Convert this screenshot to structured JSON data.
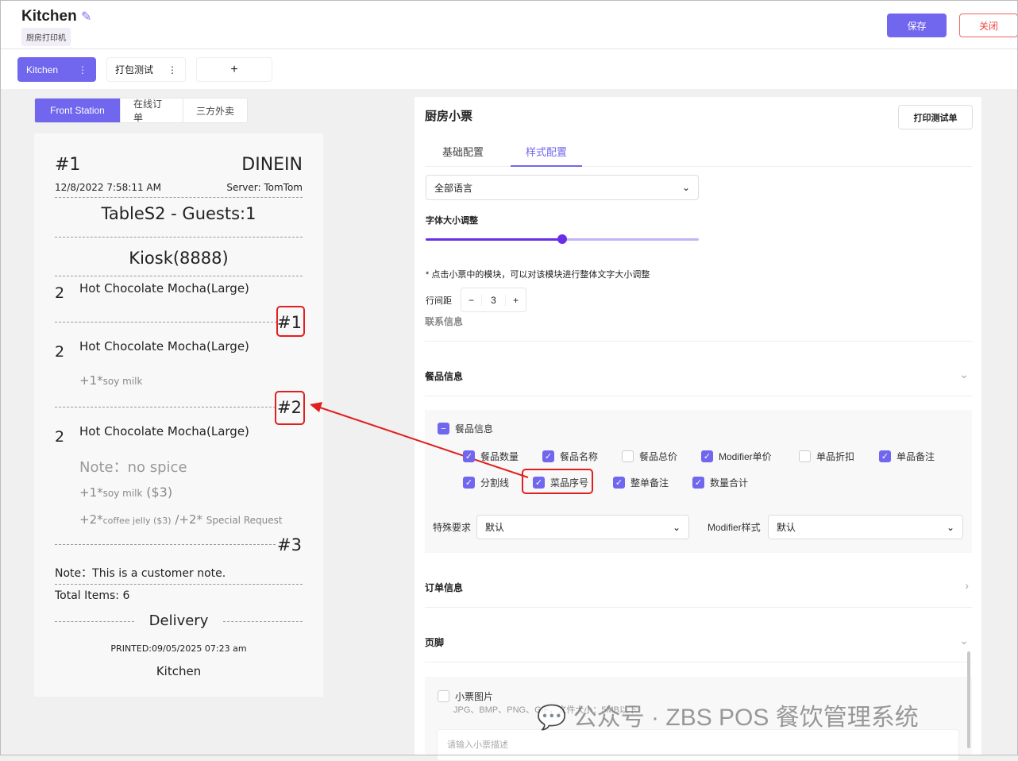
{
  "header": {
    "title": "Kitchen",
    "tag": "厨房打印机",
    "save": "保存",
    "close": "关闭"
  },
  "printer_tabs": [
    {
      "label": "Kitchen"
    },
    {
      "label": "打包测试"
    },
    {
      "label": "+"
    }
  ],
  "station_tabs": [
    "Front Station",
    "在线订单",
    "三方外卖"
  ],
  "receipt": {
    "order_no": "#1",
    "order_type": "DINEIN",
    "datetime": "12/8/2022 7:58:11 AM",
    "server": "Server: TomTom",
    "table": "TableS2 - Guests:1",
    "kiosk": "Kiosk(8888)",
    "items": [
      {
        "qty": "2",
        "name": "Hot Chocolate Mocha(Large)",
        "seq": "#1"
      },
      {
        "qty": "2",
        "name": "Hot Chocolate Mocha(Large)",
        "mod": "+1*",
        "mod_name": "soy milk",
        "seq": "#2"
      },
      {
        "qty": "2",
        "name": "Hot Chocolate Mocha(Large)",
        "note": "Note：no spice",
        "mod1": "+1*",
        "mod1_name": "soy milk",
        "mod1_price": "($3)",
        "mod2": "+2*",
        "mod2_name": "coffee jelly ($3)",
        "mod2_sep": "/+2*",
        "mod2_req": "Special Request",
        "seq": "#3"
      }
    ],
    "customer_note": "Note：This is a customer note.",
    "total": "Total Items: 6",
    "delivery": "Delivery",
    "printed": "PRINTED:09/05/2025 07:23 am",
    "footer": "Kitchen"
  },
  "panel": {
    "title": "厨房小票",
    "print_test": "打印测试单",
    "tabs": [
      "基础配置",
      "样式配置"
    ],
    "language": "全部语言",
    "font_size_label": "字体大小调整",
    "font_size_value": 0.5,
    "hint": "* 点击小票中的模块，可以对该模块进行整体文字大小调整",
    "line_spacing_label": "行间距",
    "line_spacing": "3",
    "sections": {
      "contact": "联系信息",
      "items": "餐品信息",
      "order": "订单信息",
      "footer": "页脚"
    },
    "item_group": "餐品信息",
    "checks": [
      {
        "label": "餐品数量",
        "on": true
      },
      {
        "label": "餐品名称",
        "on": true
      },
      {
        "label": "餐品总价",
        "on": false
      },
      {
        "label": "Modifier单价",
        "on": true
      },
      {
        "label": "单品折扣",
        "on": false
      },
      {
        "label": "单品备注",
        "on": true
      },
      {
        "label": "分割线",
        "on": true
      },
      {
        "label": "菜品序号",
        "on": true
      },
      {
        "label": "整单备注",
        "on": true
      },
      {
        "label": "数量合计",
        "on": true
      }
    ],
    "special_label": "特殊要求",
    "special_value": "默认",
    "modifier_label": "Modifier样式",
    "modifier_value": "默认",
    "image_label": "小票图片",
    "image_hint": "JPG、BMP、PNG、GIF，文件大小：5MB以下",
    "desc_placeholder": "请输入小票描述"
  },
  "watermark": "公众号 · ZBS POS 餐饮管理系统",
  "colors": {
    "accent": "#7166ee",
    "annotation": "#e02020"
  }
}
